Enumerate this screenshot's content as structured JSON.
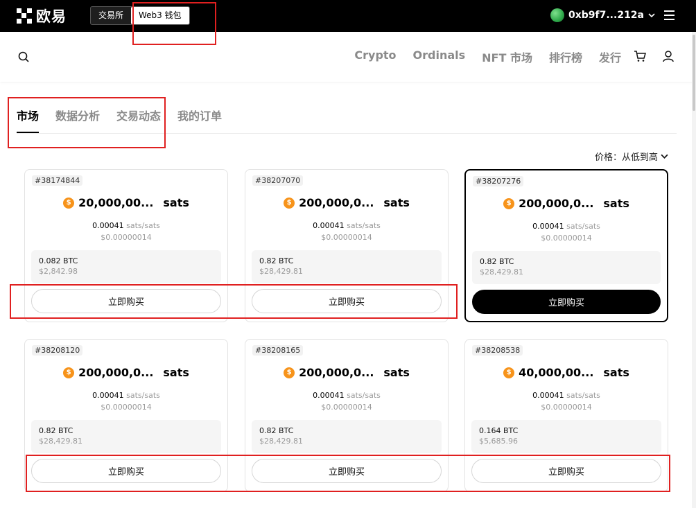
{
  "topbar": {
    "logo_text": "欧易",
    "segments": [
      "交易所",
      "Web3 钱包"
    ],
    "active_segment": 1,
    "wallet_address": "0xb9f7...212a"
  },
  "nav": {
    "links": [
      "Crypto",
      "Ordinals",
      "NFT 市场",
      "排行榜",
      "发行"
    ]
  },
  "tabs": [
    "市场",
    "数据分析",
    "交易动态",
    "我的订单"
  ],
  "sort": {
    "label": "价格：从低到高"
  },
  "cards": [
    {
      "id": "#38174844",
      "amount": "20,000,00...",
      "unit": "sats",
      "rate": "0.00041",
      "rate_unit": "sats/sats",
      "rate_usd": "$0.00000014",
      "total_btc": "0.082 BTC",
      "total_usd": "$2,842.98",
      "buy_label": "立即购买"
    },
    {
      "id": "#38207070",
      "amount": "200,000,0...",
      "unit": "sats",
      "rate": "0.00041",
      "rate_unit": "sats/sats",
      "rate_usd": "$0.00000014",
      "total_btc": "0.82 BTC",
      "total_usd": "$28,429.81",
      "buy_label": "立即购买"
    },
    {
      "id": "#38207276",
      "amount": "200,000,0...",
      "unit": "sats",
      "rate": "0.00041",
      "rate_unit": "sats/sats",
      "rate_usd": "$0.00000014",
      "total_btc": "0.82 BTC",
      "total_usd": "$28,429.81",
      "buy_label": "立即购买"
    },
    {
      "id": "#38208120",
      "amount": "200,000,0...",
      "unit": "sats",
      "rate": "0.00041",
      "rate_unit": "sats/sats",
      "rate_usd": "$0.00000014",
      "total_btc": "0.82 BTC",
      "total_usd": "$28,429.81",
      "buy_label": "立即购买"
    },
    {
      "id": "#38208165",
      "amount": "200,000,0...",
      "unit": "sats",
      "rate": "0.00041",
      "rate_unit": "sats/sats",
      "rate_usd": "$0.00000014",
      "total_btc": "0.82 BTC",
      "total_usd": "$28,429.81",
      "buy_label": "立即购买"
    },
    {
      "id": "#38208538",
      "amount": "40,000,00...",
      "unit": "sats",
      "rate": "0.00041",
      "rate_unit": "sats/sats",
      "rate_usd": "$0.00000014",
      "total_btc": "0.164 BTC",
      "total_usd": "$5,685.96",
      "buy_label": "立即购买"
    }
  ],
  "coin_symbol": "$",
  "colors": {
    "accent": "#000000",
    "coin": "#f7931a",
    "annotation": "#e02020"
  }
}
